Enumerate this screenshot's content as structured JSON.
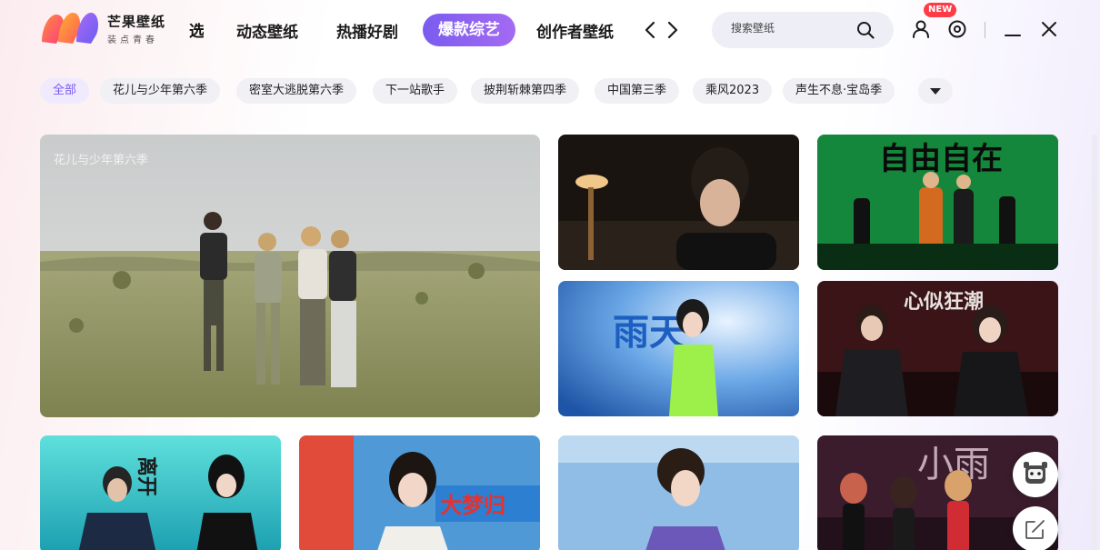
{
  "app": {
    "name": "芒果壁纸",
    "slogan": "装点青春"
  },
  "colors": {
    "accent": "#7a5cf0",
    "new_badge": "#ff3b45"
  },
  "nav": {
    "cut_item": "选",
    "items": [
      {
        "label": "动态壁纸"
      },
      {
        "label": "热播好剧"
      },
      {
        "label": "爆款综艺",
        "active": true
      },
      {
        "label": "创作者壁纸"
      }
    ],
    "prev_icon": "chevron-left-icon",
    "next_icon": "chevron-right-icon"
  },
  "search": {
    "placeholder": "搜索壁纸",
    "icon": "search-icon"
  },
  "window": {
    "user_icon": "user-icon",
    "new_badge": "NEW",
    "settings_icon": "settings-icon",
    "minimize_icon": "minimize-icon",
    "close_icon": "close-icon"
  },
  "tags": [
    {
      "label": "全部",
      "active": true
    },
    {
      "label": "花儿与少年第六季"
    },
    {
      "label": "密室大逃脱第六季"
    },
    {
      "label": "下一站歌手"
    },
    {
      "label": "披荆斩棘第四季"
    },
    {
      "label": "中国第三季"
    },
    {
      "label": "乘风2023"
    },
    {
      "label": "声生不息·宝岛季"
    }
  ],
  "tags_more_icon": "caret-down-icon",
  "gallery": {
    "featured_label": "花儿与少年第六季",
    "card_texts": {
      "freedom": "自由自在",
      "rain": "雨天",
      "tide": "心似狂潮",
      "leave": "离开",
      "dream": "大梦归",
      "xiaoyu": "小雨"
    }
  },
  "floating": {
    "pet_icon": "pet-icon",
    "edit_icon": "edit-icon"
  }
}
